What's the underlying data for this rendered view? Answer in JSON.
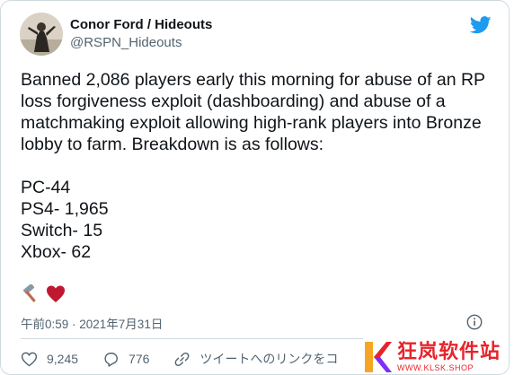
{
  "user": {
    "display_name": "Conor Ford / Hideouts",
    "handle": "@RSPN_Hideouts",
    "avatar_icon": "profile-photo"
  },
  "tweet": {
    "text": "Banned 2,086 players early this morning for abuse of an RP loss forgiveness exploit (dashboarding) and abuse of a matchmaking exploit allowing high-rank players into Bronze lobby to farm. Breakdown is as follows:\n\nPC-44\nPS4- 1,965\nSwitch- 15\nXbox- 62",
    "emojis": [
      "hammer-icon",
      "heart-icon"
    ],
    "timestamp": "午前0:59 · 2021年7月31日"
  },
  "actions": {
    "likes": "9,245",
    "replies": "776",
    "share_label": "ツイートへのリンクをコ"
  },
  "watermark": {
    "title": "狂岚软件站",
    "url": "WWW.KLSK.SHOP"
  },
  "colors": {
    "twitter_blue": "#1d9bf0",
    "text": "#0f1419",
    "secondary": "#536471",
    "heart": "#be1931",
    "watermark_red": "#e8232b"
  }
}
